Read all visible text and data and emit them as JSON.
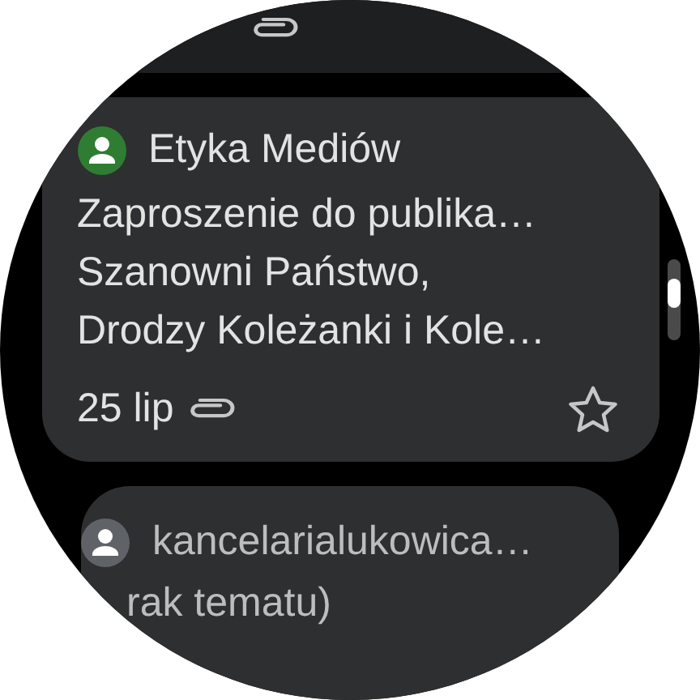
{
  "emails": [
    {
      "kind": "partial",
      "has_attachment": true
    },
    {
      "kind": "full",
      "sender": "Etyka Mediów",
      "color": "#2e7d32",
      "subject": "Zaproszenie do publika…",
      "preview_lines": [
        "Szanowni Państwo,",
        "Drodzy Koleżanki i Kole…"
      ],
      "date": "25 lip",
      "has_attachment": true,
      "starred": false
    },
    {
      "kind": "header",
      "sender": "kancelarialukowica…",
      "color": "#5f6368",
      "subject": "rak tematu)"
    }
  ]
}
